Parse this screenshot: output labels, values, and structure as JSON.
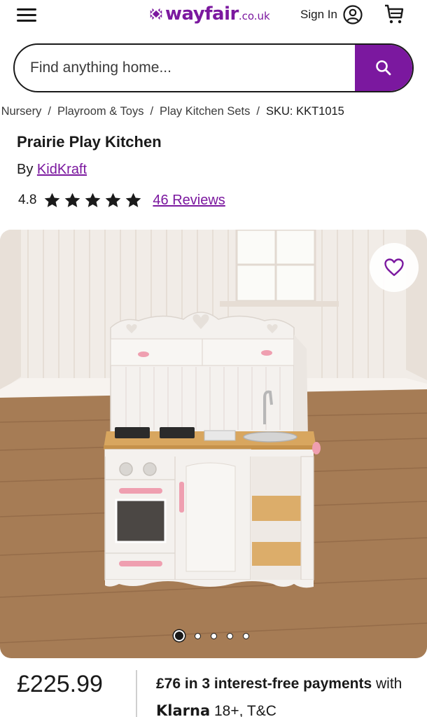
{
  "header": {
    "logo_word": "wayfair",
    "logo_tld": ".co.uk",
    "sign_in_label": "Sign In",
    "brand_color": "#7b189f"
  },
  "search": {
    "placeholder": "Find anything home..."
  },
  "breadcrumb": {
    "items": [
      "& Nursery",
      "Playroom & Toys",
      "Play Kitchen Sets"
    ],
    "current": "SKU: KKT1015",
    "separator": "/"
  },
  "product": {
    "title": "Prairie Play Kitchen",
    "by_label": "By",
    "brand": "KidKraft",
    "rating_value": "4.8",
    "rating_stars": 4.8,
    "reviews_label": "46 Reviews"
  },
  "gallery": {
    "image_count": 5,
    "active_index": 0
  },
  "pricing": {
    "price": "£225.99",
    "klarna_amount": "£76 in 3 interest-free payments",
    "klarna_with": "with",
    "klarna_brand": "Klarna",
    "klarna_terms": "18+, T&C"
  },
  "icons": {
    "menu": "hamburger-icon",
    "account": "user-circle-icon",
    "cart": "cart-icon",
    "search": "search-icon",
    "favourite": "heart-icon",
    "star": "star-icon"
  }
}
